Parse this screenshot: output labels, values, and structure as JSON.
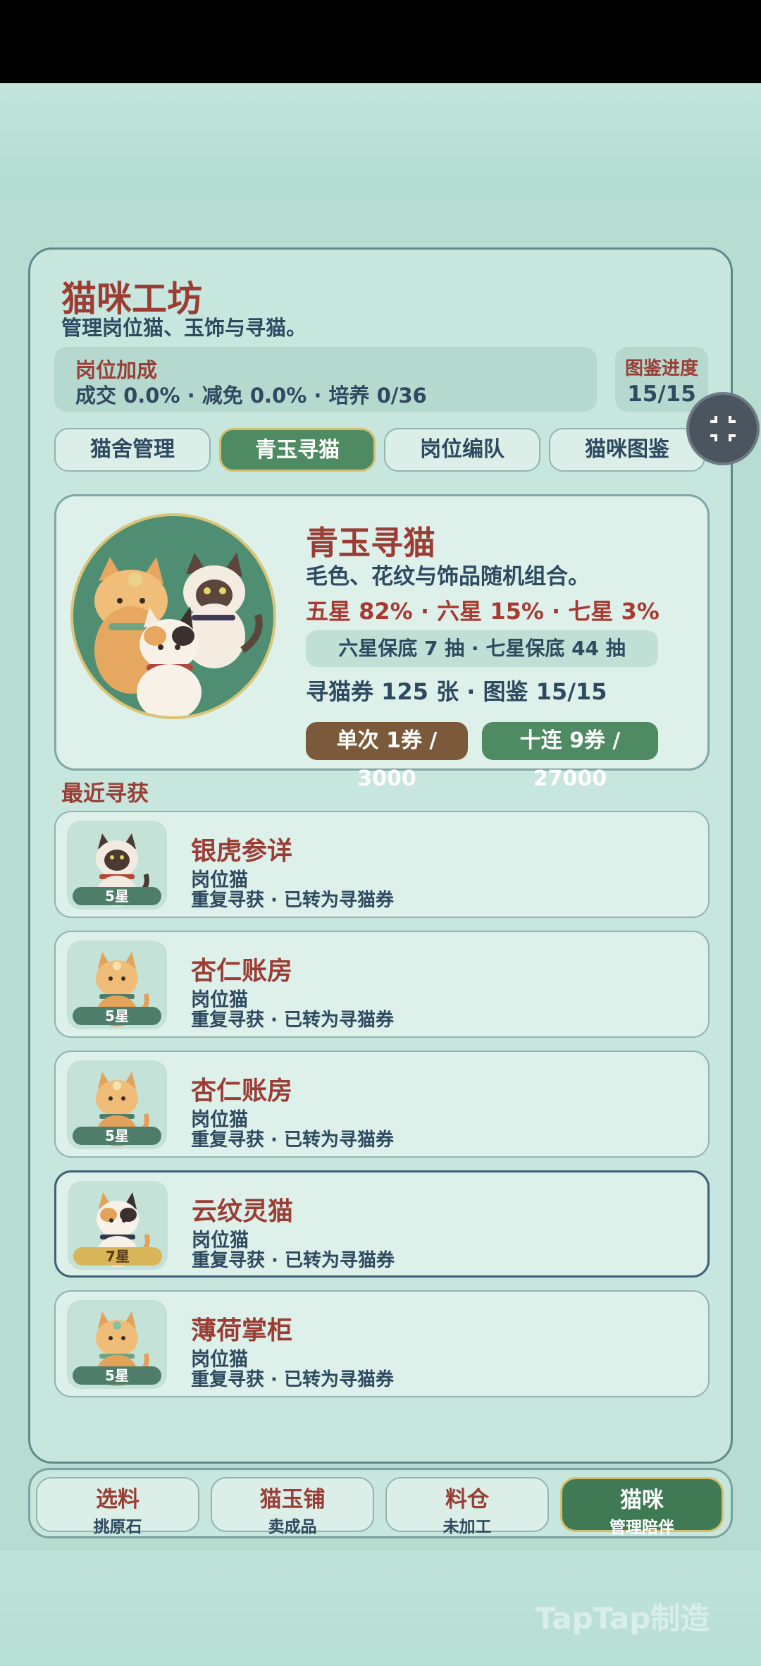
{
  "header": {
    "title": "猫咪工坊",
    "subtitle": "管理岗位猫、玉饰与寻猫。"
  },
  "bonus": {
    "label": "岗位加成",
    "stats": "成交 0.0% · 减免 0.0% · 培养 0/36"
  },
  "collection": {
    "label": "图鉴进度",
    "value": "15/15"
  },
  "tabs": [
    {
      "label": "猫舍管理",
      "active": false
    },
    {
      "label": "青玉寻猫",
      "active": true
    },
    {
      "label": "岗位编队",
      "active": false
    },
    {
      "label": "猫咪图鉴",
      "active": false
    }
  ],
  "gacha": {
    "title": "青玉寻猫",
    "description": "毛色、花纹与饰品随机组合。",
    "rates": "五星 82% · 六星 15% · 七星 3%",
    "pity": "六星保底 7 抽 · 七星保底 44 抽",
    "tickets": "寻猫券 125 张 · 图鉴 15/15",
    "single_button": "单次 1券 / 3000",
    "ten_button": "十连 9券 / 27000"
  },
  "recent": {
    "label": "最近寻获",
    "items": [
      {
        "name": "银虎参详",
        "role": "岗位猫",
        "note": "重复寻获 · 已转为寻猫券",
        "stars": "5星",
        "gold": false,
        "highlight": false,
        "cat": "siamese"
      },
      {
        "name": "杏仁账房",
        "role": "岗位猫",
        "note": "重复寻获 · 已转为寻猫券",
        "stars": "5星",
        "gold": false,
        "highlight": false,
        "cat": "orange"
      },
      {
        "name": "杏仁账房",
        "role": "岗位猫",
        "note": "重复寻获 · 已转为寻猫券",
        "stars": "5星",
        "gold": false,
        "highlight": false,
        "cat": "orange"
      },
      {
        "name": "云纹灵猫",
        "role": "岗位猫",
        "note": "重复寻获 · 已转为寻猫券",
        "stars": "7星",
        "gold": true,
        "highlight": true,
        "cat": "calico"
      },
      {
        "name": "薄荷掌柜",
        "role": "岗位猫",
        "note": "重复寻获 · 已转为寻猫券",
        "stars": "5星",
        "gold": false,
        "highlight": false,
        "cat": "orange-green"
      }
    ]
  },
  "bottom_nav": [
    {
      "label": "选料",
      "sub": "挑原石",
      "active": false
    },
    {
      "label": "猫玉铺",
      "sub": "卖成品",
      "active": false
    },
    {
      "label": "料仓",
      "sub": "未加工",
      "active": false
    },
    {
      "label": "猫咪",
      "sub": "管理陪伴",
      "active": true
    }
  ],
  "watermark": "TapTap制造",
  "colors": {
    "accent_red": "#9a3e35",
    "accent_green": "#4e8a62",
    "text_dark": "#2e4a60",
    "panel_bg": "#c7e6dd"
  }
}
